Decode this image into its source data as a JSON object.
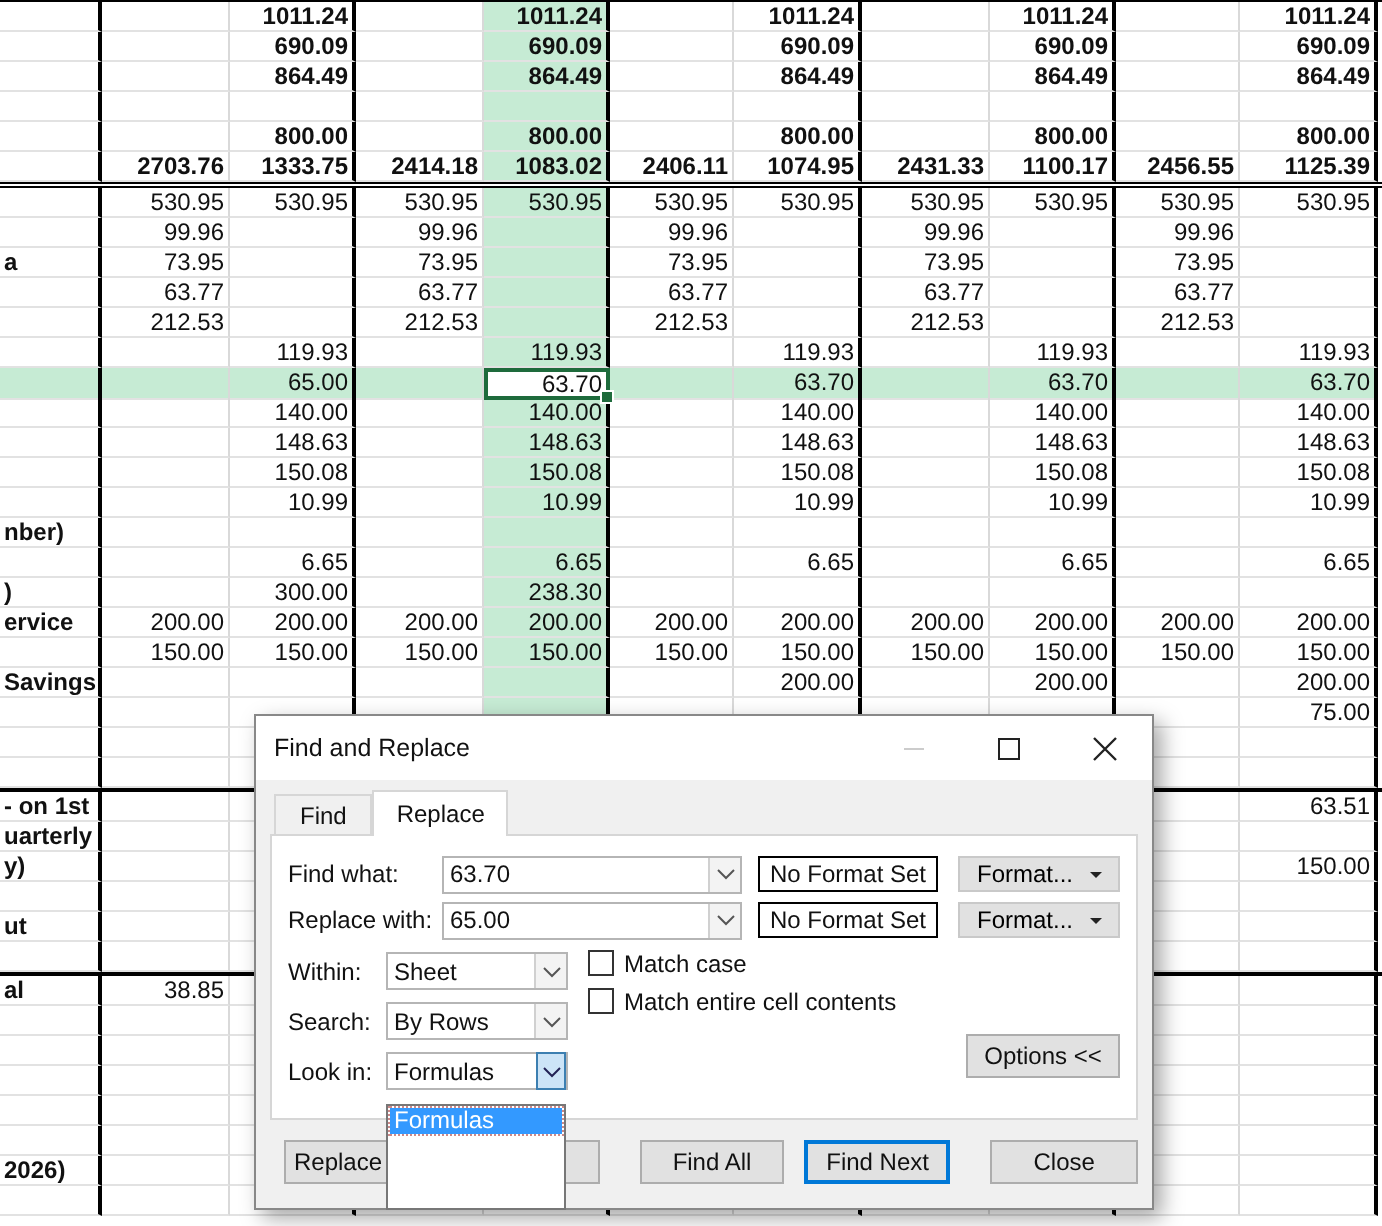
{
  "sheet": {
    "columns": [
      {
        "selected": false
      },
      {
        "selected": false
      },
      {
        "selected": false
      },
      {
        "selected": false
      },
      {
        "selected": true
      },
      {
        "selected": false
      },
      {
        "selected": false
      },
      {
        "selected": false
      },
      {
        "selected": false
      },
      {
        "selected": false
      },
      {
        "selected": false
      }
    ],
    "sections": [
      {
        "bold": true,
        "rows": [
          {
            "selected": false,
            "cells": [
              null,
              null,
              "1011.24",
              null,
              "1011.24",
              null,
              "1011.24",
              null,
              "1011.24",
              null,
              "1011.24"
            ]
          },
          {
            "selected": false,
            "cells": [
              null,
              null,
              "690.09",
              null,
              "690.09",
              null,
              "690.09",
              null,
              "690.09",
              null,
              "690.09"
            ]
          },
          {
            "selected": false,
            "cells": [
              null,
              null,
              "864.49",
              null,
              "864.49",
              null,
              "864.49",
              null,
              "864.49",
              null,
              "864.49"
            ]
          },
          {
            "selected": false,
            "cells": [
              null,
              null,
              null,
              null,
              null,
              null,
              null,
              null,
              null,
              null,
              null
            ]
          },
          {
            "selected": false,
            "cells": [
              null,
              null,
              "800.00",
              null,
              "800.00",
              null,
              "800.00",
              null,
              "800.00",
              null,
              "800.00"
            ]
          },
          {
            "selected": false,
            "cells": [
              null,
              "2703.76",
              "1333.75",
              "2414.18",
              "1083.02",
              "2406.11",
              "1074.95",
              "2431.33",
              "1100.17",
              "2456.55",
              "1125.39"
            ]
          }
        ]
      },
      {
        "bold": false,
        "rows": [
          {
            "selected": false,
            "cells": [
              null,
              "530.95",
              "530.95",
              "530.95",
              "530.95",
              "530.95",
              "530.95",
              "530.95",
              "530.95",
              "530.95",
              "530.95"
            ]
          },
          {
            "selected": false,
            "cells": [
              null,
              "99.96",
              null,
              "99.96",
              null,
              "99.96",
              null,
              "99.96",
              null,
              "99.96",
              null
            ]
          },
          {
            "selected": false,
            "cells": [
              "a",
              "73.95",
              null,
              "73.95",
              null,
              "73.95",
              null,
              "73.95",
              null,
              "73.95",
              null
            ]
          },
          {
            "selected": false,
            "cells": [
              null,
              "63.77",
              null,
              "63.77",
              null,
              "63.77",
              null,
              "63.77",
              null,
              "63.77",
              null
            ]
          },
          {
            "selected": false,
            "cells": [
              null,
              "212.53",
              null,
              "212.53",
              null,
              "212.53",
              null,
              "212.53",
              null,
              "212.53",
              null
            ]
          },
          {
            "selected": false,
            "cells": [
              null,
              null,
              "119.93",
              null,
              "119.93",
              null,
              "119.93",
              null,
              "119.93",
              null,
              "119.93"
            ]
          },
          {
            "selected": true,
            "cells": [
              null,
              null,
              "65.00",
              null,
              "63.70",
              null,
              "63.70",
              null,
              "63.70",
              null,
              "63.70"
            ]
          },
          {
            "selected": false,
            "cells": [
              null,
              null,
              "140.00",
              null,
              "140.00",
              null,
              "140.00",
              null,
              "140.00",
              null,
              "140.00"
            ]
          },
          {
            "selected": false,
            "cells": [
              null,
              null,
              "148.63",
              null,
              "148.63",
              null,
              "148.63",
              null,
              "148.63",
              null,
              "148.63"
            ]
          },
          {
            "selected": false,
            "cells": [
              null,
              null,
              "150.08",
              null,
              "150.08",
              null,
              "150.08",
              null,
              "150.08",
              null,
              "150.08"
            ]
          },
          {
            "selected": false,
            "cells": [
              null,
              null,
              "10.99",
              null,
              "10.99",
              null,
              "10.99",
              null,
              "10.99",
              null,
              "10.99"
            ]
          },
          {
            "selected": false,
            "cells": [
              "nber)",
              null,
              null,
              null,
              null,
              null,
              null,
              null,
              null,
              null,
              null
            ]
          },
          {
            "selected": false,
            "cells": [
              null,
              null,
              "6.65",
              null,
              "6.65",
              null,
              "6.65",
              null,
              "6.65",
              null,
              "6.65"
            ]
          },
          {
            "selected": false,
            "cells": [
              ")",
              null,
              "300.00",
              null,
              "238.30",
              null,
              null,
              null,
              null,
              null,
              null
            ]
          },
          {
            "selected": false,
            "cells": [
              "ervice",
              "200.00",
              "200.00",
              "200.00",
              "200.00",
              "200.00",
              "200.00",
              "200.00",
              "200.00",
              "200.00",
              "200.00"
            ]
          },
          {
            "selected": false,
            "cells": [
              null,
              "150.00",
              "150.00",
              "150.00",
              "150.00",
              "150.00",
              "150.00",
              "150.00",
              "150.00",
              "150.00",
              "150.00"
            ]
          },
          {
            "selected": false,
            "cells": [
              "Savings",
              null,
              null,
              null,
              null,
              null,
              "200.00",
              null,
              "200.00",
              null,
              "200.00"
            ]
          },
          {
            "selected": false,
            "cells": [
              null,
              null,
              null,
              null,
              null,
              null,
              null,
              null,
              null,
              null,
              "75.00"
            ]
          },
          {
            "selected": false,
            "cells": [
              null,
              null,
              null,
              null,
              null,
              null,
              null,
              null,
              null,
              null,
              null
            ]
          },
          {
            "selected": false,
            "cells": [
              null,
              null,
              null,
              null,
              null,
              null,
              null,
              null,
              null,
              null,
              null
            ]
          }
        ]
      },
      {
        "bold": false,
        "rows": [
          {
            "selected": false,
            "cells": [
              "- on 1st",
              null,
              null,
              null,
              null,
              null,
              null,
              null,
              null,
              null,
              "63.51"
            ]
          },
          {
            "selected": false,
            "cells": [
              "uarterly",
              null,
              null,
              null,
              null,
              null,
              null,
              null,
              null,
              null,
              null
            ]
          },
          {
            "selected": false,
            "cells": [
              "y)",
              null,
              null,
              null,
              null,
              null,
              null,
              null,
              null,
              null,
              "150.00"
            ]
          },
          {
            "selected": false,
            "cells": [
              null,
              null,
              null,
              null,
              null,
              null,
              null,
              null,
              null,
              null,
              null
            ]
          },
          {
            "selected": false,
            "cells": [
              "ut",
              null,
              null,
              null,
              null,
              null,
              null,
              null,
              null,
              null,
              null
            ]
          },
          {
            "selected": false,
            "cells": [
              null,
              null,
              null,
              null,
              null,
              null,
              null,
              null,
              null,
              null,
              null
            ]
          }
        ]
      },
      {
        "bold": false,
        "rows": [
          {
            "selected": false,
            "cells": [
              "al",
              "38.85",
              null,
              null,
              null,
              null,
              null,
              null,
              null,
              null,
              null
            ]
          },
          {
            "selected": false,
            "cells": [
              null,
              null,
              null,
              null,
              null,
              null,
              null,
              null,
              null,
              null,
              null
            ]
          },
          {
            "selected": false,
            "cells": [
              null,
              null,
              null,
              null,
              null,
              null,
              null,
              null,
              null,
              null,
              null
            ]
          },
          {
            "selected": false,
            "cells": [
              null,
              null,
              null,
              null,
              null,
              null,
              null,
              null,
              null,
              null,
              null
            ]
          },
          {
            "selected": false,
            "cells": [
              null,
              null,
              null,
              null,
              null,
              null,
              null,
              null,
              null,
              null,
              null
            ]
          },
          {
            "selected": false,
            "cells": [
              null,
              null,
              null,
              null,
              null,
              null,
              null,
              null,
              null,
              null,
              null
            ]
          },
          {
            "selected": false,
            "cells": [
              " 2026)",
              null,
              null,
              null,
              null,
              null,
              null,
              null,
              null,
              null,
              null
            ]
          },
          {
            "selected": false,
            "cells": [
              null,
              null,
              null,
              null,
              null,
              null,
              null,
              null,
              null,
              null,
              null
            ]
          }
        ]
      }
    ]
  },
  "dialog": {
    "title": "Find and Replace",
    "tabs": [
      {
        "label": "Find",
        "selected": false
      },
      {
        "label": "Replace",
        "selected": true
      }
    ],
    "fields": [
      {
        "label": "Find what:",
        "value": "63.70",
        "format": "No Format Set",
        "format_button": "Format..."
      },
      {
        "label": "Replace with:",
        "value": "65.00",
        "format": "No Format Set",
        "format_button": "Format..."
      }
    ],
    "selects": [
      {
        "label": "Within:",
        "value": "Sheet",
        "open": false
      },
      {
        "label": "Search:",
        "value": "By Rows",
        "open": false
      },
      {
        "label": "Look in:",
        "value": "Formulas",
        "open": true
      }
    ],
    "checkboxes": [
      {
        "label": "Match case",
        "checked": false
      },
      {
        "label": "Match entire cell contents",
        "checked": false
      }
    ],
    "options_button": "Options <<",
    "dropdown_list": [
      {
        "label": "Formulas",
        "selected": true
      }
    ],
    "buttons": [
      {
        "kind": "text",
        "label": "Replace",
        "default": false
      },
      {
        "kind": "covered",
        "default": false
      },
      {
        "kind": "text",
        "label": "Find All",
        "default": false
      },
      {
        "kind": "text",
        "label": "Find Next",
        "default": true
      },
      {
        "kind": "text",
        "label": "Close",
        "default": false
      }
    ]
  }
}
